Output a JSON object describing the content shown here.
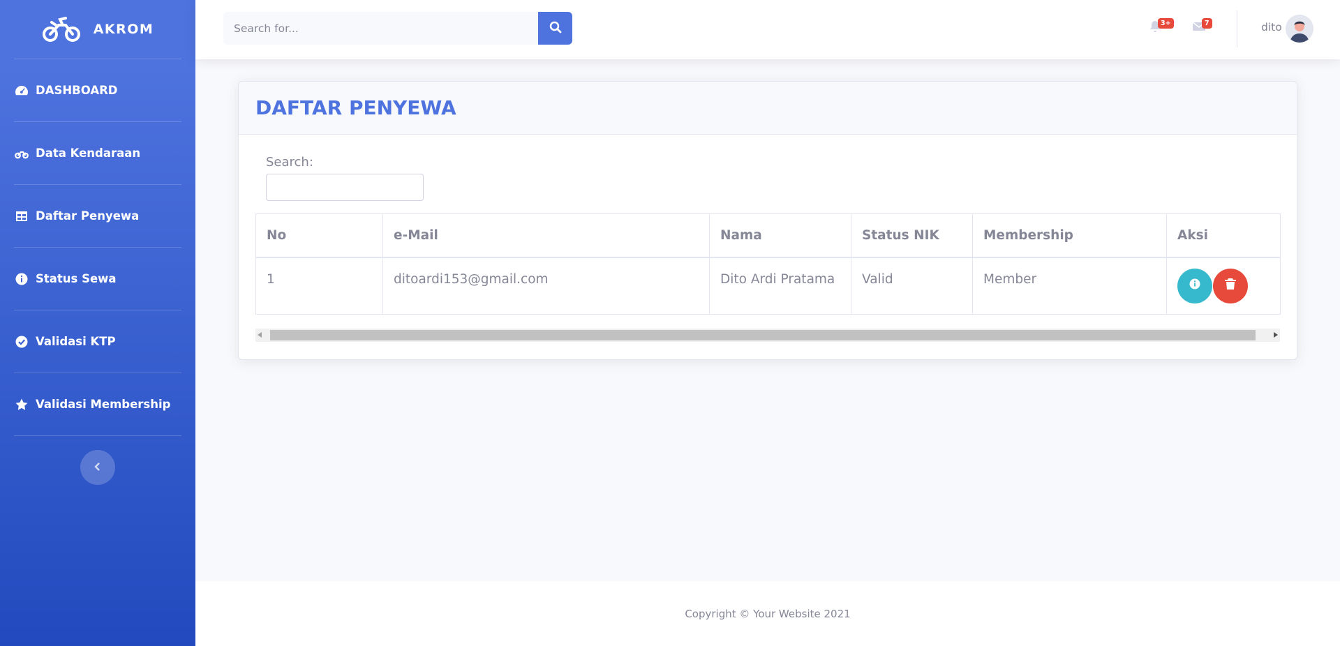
{
  "sidebar": {
    "brand": "AKROM",
    "brand_icon": "motorcycle-icon",
    "items": [
      {
        "label": "DASHBOARD",
        "icon": "tachometer-icon"
      },
      {
        "label": "Data Kendaraan",
        "icon": "motorcycle-icon"
      },
      {
        "label": "Daftar Penyewa",
        "icon": "table-icon"
      },
      {
        "label": "Status Sewa",
        "icon": "info-circle-icon"
      },
      {
        "label": "Validasi KTP",
        "icon": "check-circle-icon"
      },
      {
        "label": "Validasi Membership",
        "icon": "star-icon"
      }
    ],
    "toggle_icon": "chevron-left-icon"
  },
  "topbar": {
    "search_placeholder": "Search for...",
    "alerts_badge": "3+",
    "messages_badge": "7",
    "user_name": "dito"
  },
  "main": {
    "title": "DAFTAR PENYEWA",
    "search_label": "Search:",
    "search_value": "",
    "table": {
      "headers": [
        "No",
        "e-Mail",
        "Nama",
        "Status NIK",
        "Membership",
        "Aksi"
      ],
      "rows": [
        {
          "no": "1",
          "email": "ditoardi153@gmail.com",
          "nama": "Dito Ardi Pratama",
          "status_nik": "Valid",
          "membership": "Member"
        }
      ]
    }
  },
  "footer": {
    "copyright": "Copyright © Your Website 2021"
  },
  "colors": {
    "primary": "#4e73df",
    "info": "#36b9cc",
    "danger": "#e74a3b",
    "text_muted": "#858796"
  }
}
